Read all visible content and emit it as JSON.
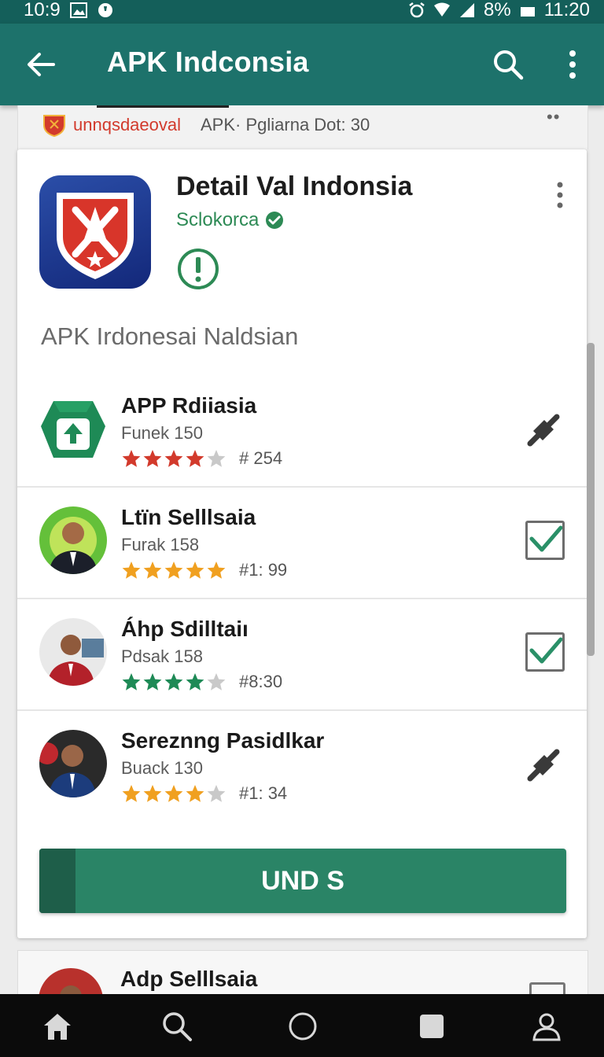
{
  "status_bar": {
    "time_left": "10:9",
    "battery": "8%",
    "time_right": "11:20"
  },
  "app_bar": {
    "title": "APK Indconsia",
    "back_icon": "arrow-left-icon",
    "search_icon": "search-icon",
    "more_icon": "more-vertical-icon"
  },
  "breadcrumb": {
    "brand": "unnqsdaeoval",
    "meta": "APK· Pgliarna Dot: 30"
  },
  "app": {
    "name": "Detail Val Indonsia",
    "developer": "Sclokorca",
    "section_label": "APK Irdonesai Naldsian"
  },
  "items": [
    {
      "title": "APP Rdiiasia",
      "subtitle": "Funek 150",
      "rating": 4,
      "star_color": "#d23a2c",
      "count": "# 254",
      "action": "link"
    },
    {
      "title": "Ltïn Selllsaia",
      "subtitle": "Furak 158",
      "rating": 5,
      "star_color": "#f0a020",
      "count": "#1: 99",
      "action": "checkbox"
    },
    {
      "title": "Áhp Sdilltaiı",
      "subtitle": "Pdsak 158",
      "rating": 4,
      "star_color": "#1e8a56",
      "count": "#8:30",
      "action": "checkbox"
    },
    {
      "title": "Sereznng Pasidlkar",
      "subtitle": "Buack 130",
      "rating": 4,
      "star_color": "#f0a020",
      "count": "#1: 34",
      "action": "link"
    }
  ],
  "primary_button": {
    "label": "UND S"
  },
  "peek_item": {
    "title": "Adp Selllsaia"
  },
  "colors": {
    "app_bar": "#1d726b",
    "status_bar": "#145f5a",
    "accent_green": "#2a8466",
    "brand_red": "#d23a2c"
  }
}
